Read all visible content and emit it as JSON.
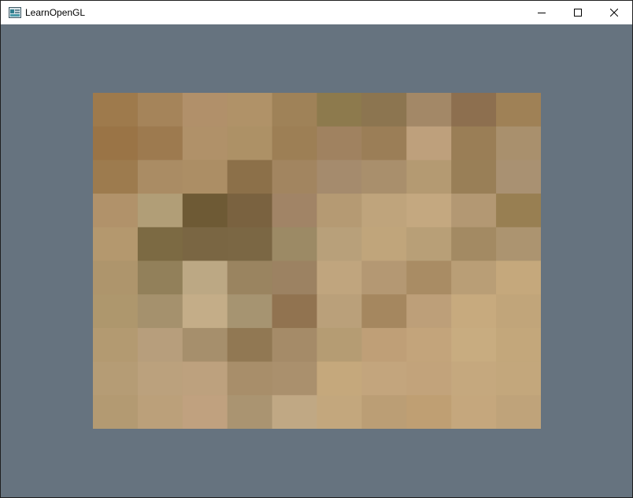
{
  "window": {
    "title": "LearnOpenGL",
    "icon": "opengl-app-icon",
    "controls": {
      "minimize_icon": "minimize-icon",
      "maximize_icon": "maximize-icon",
      "close_icon": "close-icon"
    }
  },
  "scene": {
    "clear_color": "#66737f",
    "texture": {
      "description_grid_cols": 10,
      "description_grid_rows": 10,
      "pixels": [
        [
          "#9e7a4c",
          "#a5845a",
          "#b1906a",
          "#b09268",
          "#9f8258",
          "#8d7a4d",
          "#8c7550",
          "#a38867",
          "#8d6f4f",
          "#9f8156"
        ],
        [
          "#9a7446",
          "#9d7a4f",
          "#b09169",
          "#ad9166",
          "#9d7f55",
          "#a08260",
          "#9b7e57",
          "#bea07c",
          "#9a7e56",
          "#a9906d"
        ],
        [
          "#9d7b4e",
          "#aa8c64",
          "#ac8e65",
          "#8c7049",
          "#a28560",
          "#a58b6d",
          "#a98f6c",
          "#b49a72",
          "#997f57",
          "#a99172"
        ],
        [
          "#b1926a",
          "#b19e77",
          "#6e5a35",
          "#7a6240",
          "#a18466",
          "#b59a73",
          "#bfa47c",
          "#c4a880",
          "#b39873",
          "#987f52"
        ],
        [
          "#b4986e",
          "#7c6a43",
          "#7a6643",
          "#7b6744",
          "#9c8a65",
          "#b8a07a",
          "#c0a57b",
          "#b89f77",
          "#a38a63",
          "#ac9470"
        ],
        [
          "#ae956c",
          "#92805a",
          "#bca884",
          "#9a8460",
          "#9c8262",
          "#c0a57e",
          "#b49873",
          "#a98c64",
          "#b99e76",
          "#c5a87c"
        ],
        [
          "#ae976d",
          "#a5916d",
          "#c4ad88",
          "#a69471",
          "#917350",
          "#baa07a",
          "#a5875f",
          "#bd9f79",
          "#c7aa7e",
          "#c1a57a"
        ],
        [
          "#b39a71",
          "#b79e7c",
          "#a68f6c",
          "#917853",
          "#a58b68",
          "#b59c73",
          "#bf9f77",
          "#c3a47b",
          "#c8ac80",
          "#c3a77b"
        ],
        [
          "#b59c75",
          "#bba17d",
          "#bda17e",
          "#a88e6a",
          "#aa906d",
          "#c5a87c",
          "#c3a57d",
          "#c2a37b",
          "#c5a87e",
          "#c3a77c"
        ],
        [
          "#b39a72",
          "#bba07a",
          "#c0a17f",
          "#aa9471",
          "#c0a884",
          "#c3a77d",
          "#bb9e75",
          "#bf9f73",
          "#c5a77d",
          "#bfa37a"
        ]
      ]
    }
  }
}
